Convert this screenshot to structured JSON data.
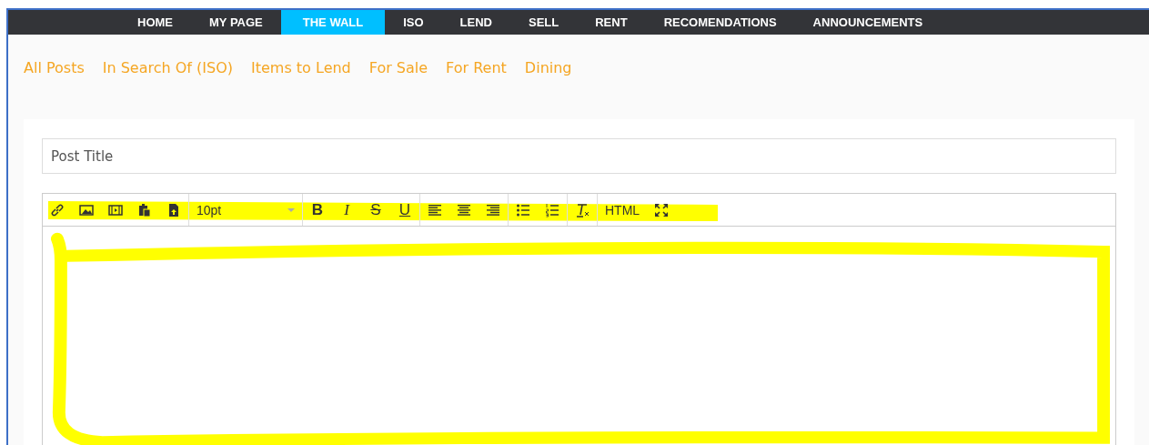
{
  "nav": [
    {
      "label": "HOME",
      "selected": false
    },
    {
      "label": "MY PAGE",
      "selected": false
    },
    {
      "label": "THE WALL",
      "selected": true
    },
    {
      "label": "ISO",
      "selected": false
    },
    {
      "label": "LEND",
      "selected": false
    },
    {
      "label": "SELL",
      "selected": false
    },
    {
      "label": "RENT",
      "selected": false
    },
    {
      "label": "RECOMENDATIONS",
      "selected": false
    },
    {
      "label": "ANNOUNCEMENTS",
      "selected": false
    }
  ],
  "filters": [
    "All Posts",
    "In Search Of (ISO)",
    "Items to Lend",
    "For Sale",
    "For Rent",
    "Dining"
  ],
  "post_title": {
    "placeholder": "Post Title"
  },
  "toolbar": {
    "font_size": "10pt",
    "format_buttons": [
      "B",
      "I",
      "S",
      "U"
    ],
    "source_button": "HTML"
  }
}
